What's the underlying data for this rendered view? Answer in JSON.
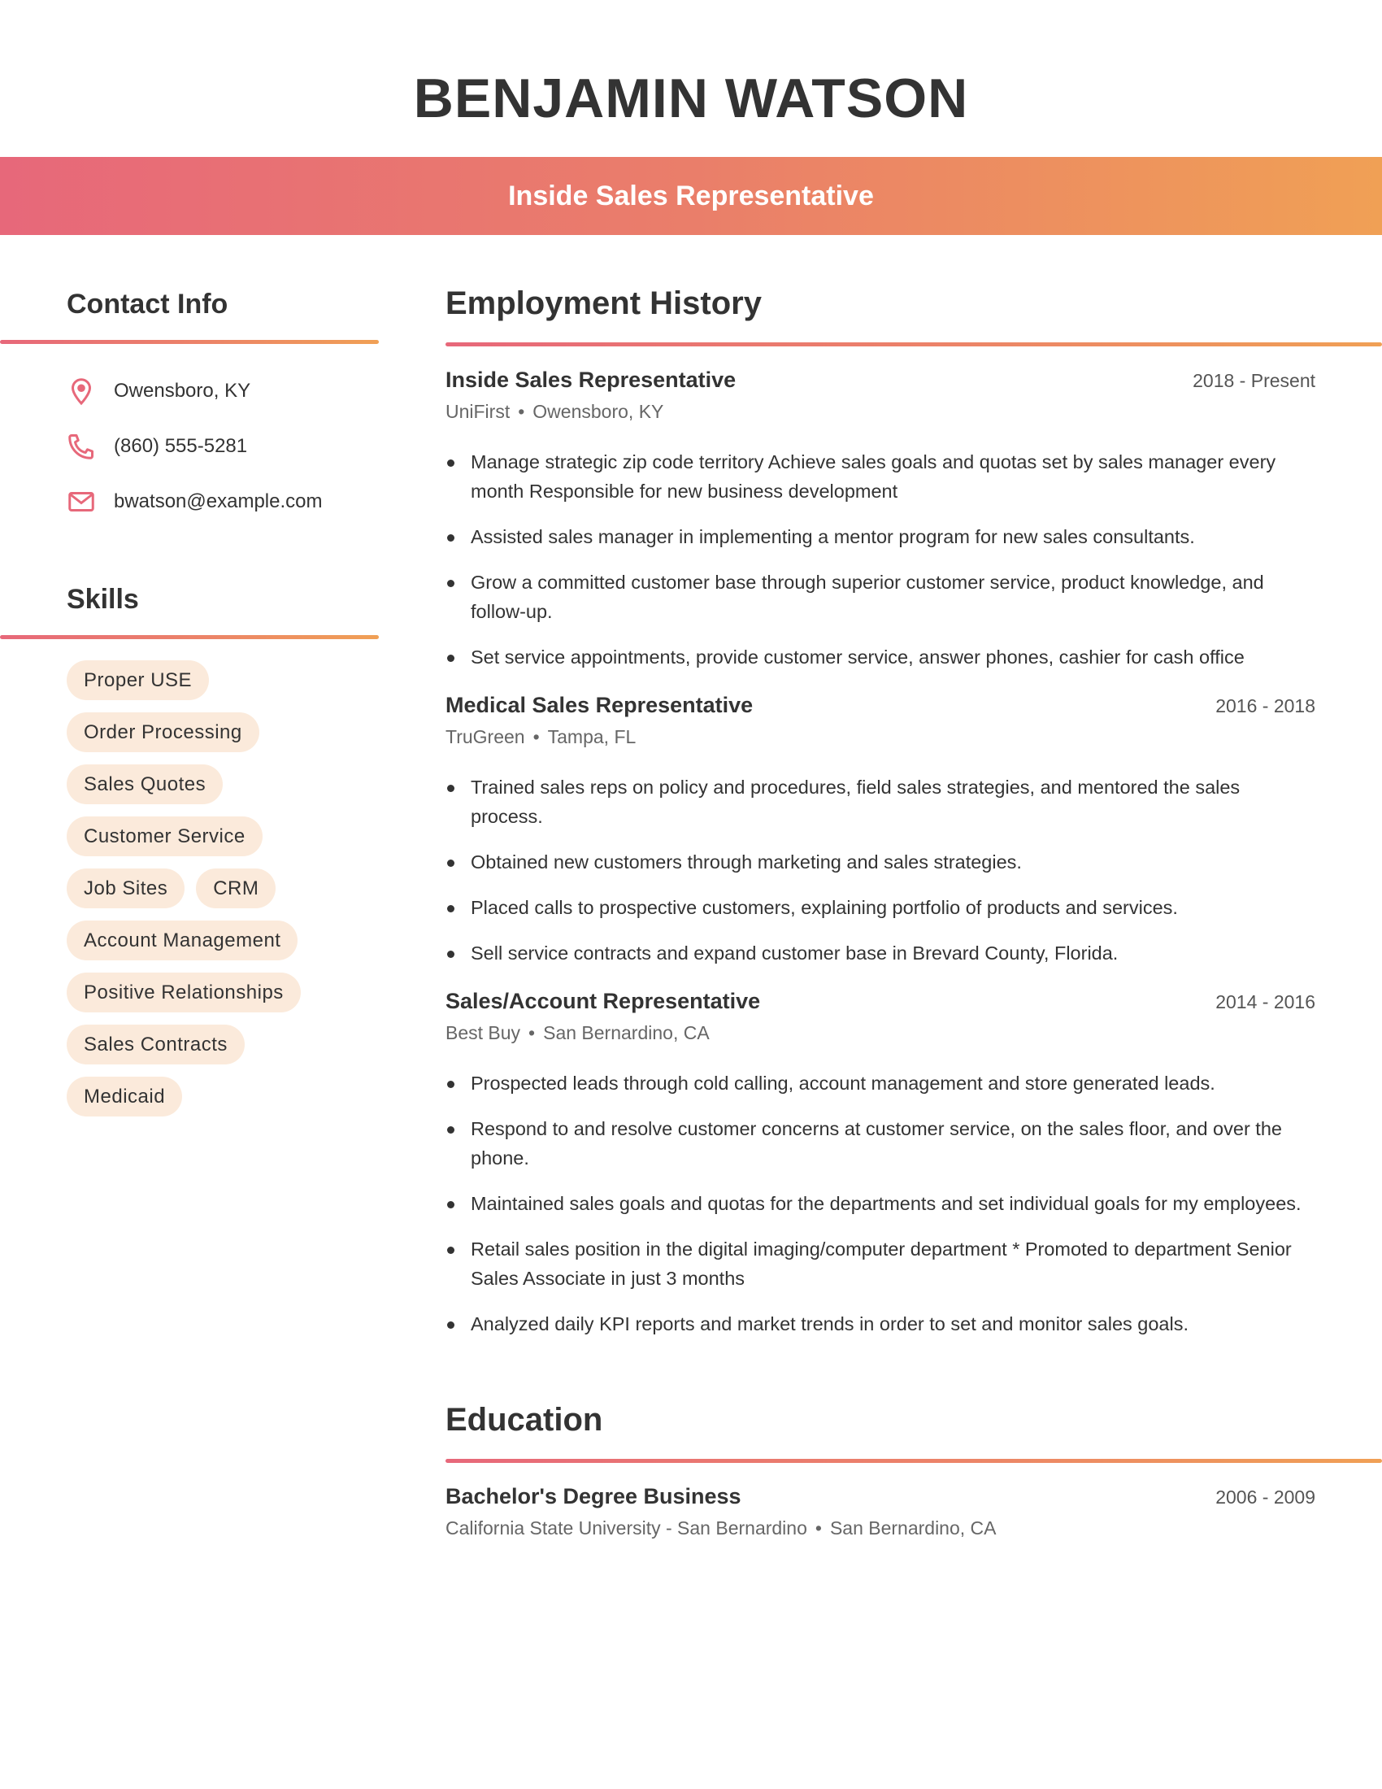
{
  "header": {
    "name": "BENJAMIN WATSON",
    "title": "Inside Sales Representative"
  },
  "colors": {
    "gradient_start": "#e7687a",
    "gradient_end": "#f0a055",
    "pill_bg": "#fbeadb",
    "icon": "#e7687a"
  },
  "contact": {
    "heading": "Contact Info",
    "items": [
      {
        "icon": "map-pin-icon",
        "text": "Owensboro, KY"
      },
      {
        "icon": "phone-icon",
        "text": "(860) 555-5281"
      },
      {
        "icon": "envelope-icon",
        "text": "bwatson@example.com"
      }
    ]
  },
  "skills": {
    "heading": "Skills",
    "items": [
      "Proper USE",
      "Order Processing",
      "Sales Quotes",
      "Customer Service",
      "Job Sites",
      "CRM",
      "Account Management",
      "Positive Relationships",
      "Sales Contracts",
      "Medicaid"
    ]
  },
  "employment": {
    "heading": "Employment History",
    "jobs": [
      {
        "title": "Inside Sales Representative",
        "dates": "2018 - Present",
        "company": "UniFirst",
        "location": "Owensboro, KY",
        "bullets": [
          "Manage strategic zip code territory Achieve sales goals and quotas set by sales manager every month Responsible for new business development",
          "Assisted sales manager in implementing a mentor program for new sales consultants.",
          "Grow a committed customer base through superior customer service, product knowledge, and follow-up.",
          "Set service appointments, provide customer service, answer phones, cashier for cash office"
        ]
      },
      {
        "title": "Medical Sales Representative",
        "dates": "2016 - 2018",
        "company": "TruGreen",
        "location": "Tampa, FL",
        "bullets": [
          "Trained sales reps on policy and procedures, field sales strategies, and mentored the sales process.",
          "Obtained new customers through marketing and sales strategies.",
          "Placed calls to prospective customers, explaining portfolio of products and services.",
          "Sell service contracts and expand customer base in Brevard County, Florida."
        ]
      },
      {
        "title": "Sales/Account Representative",
        "dates": "2014 - 2016",
        "company": "Best Buy",
        "location": "San Bernardino, CA",
        "bullets": [
          "Prospected leads through cold calling, account management and store generated leads.",
          "Respond to and resolve customer concerns at customer service, on the sales floor, and over the phone.",
          "Maintained sales goals and quotas for the departments and set individual goals for my employees.",
          "Retail sales position in the digital imaging/computer department * Promoted to department Senior Sales Associate in just 3 months",
          "Analyzed daily KPI reports and market trends in order to set and monitor sales goals."
        ]
      }
    ]
  },
  "education": {
    "heading": "Education",
    "items": [
      {
        "degree": "Bachelor's Degree Business",
        "dates": "2006 - 2009",
        "school": "California State University - San Bernardino",
        "location": "San Bernardino, CA"
      }
    ]
  },
  "separator": "•"
}
